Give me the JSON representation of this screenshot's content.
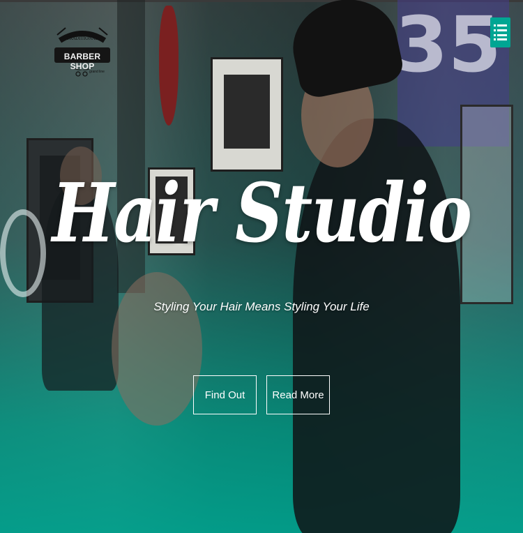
{
  "logo": {
    "top_text": "TRADITIONAL",
    "main_text": "BARBER SHOP",
    "bottom_text": "grand line"
  },
  "menu": {
    "icon": "list-menu-icon"
  },
  "hero": {
    "title": "Hair Studio",
    "subtitle": "Styling Your Hair Means Styling Your Life"
  },
  "buttons": {
    "find_out": "Find Out",
    "read_more": "Read More"
  },
  "colors": {
    "accent": "#00a693",
    "overlay_bottom": "#00a08c"
  }
}
